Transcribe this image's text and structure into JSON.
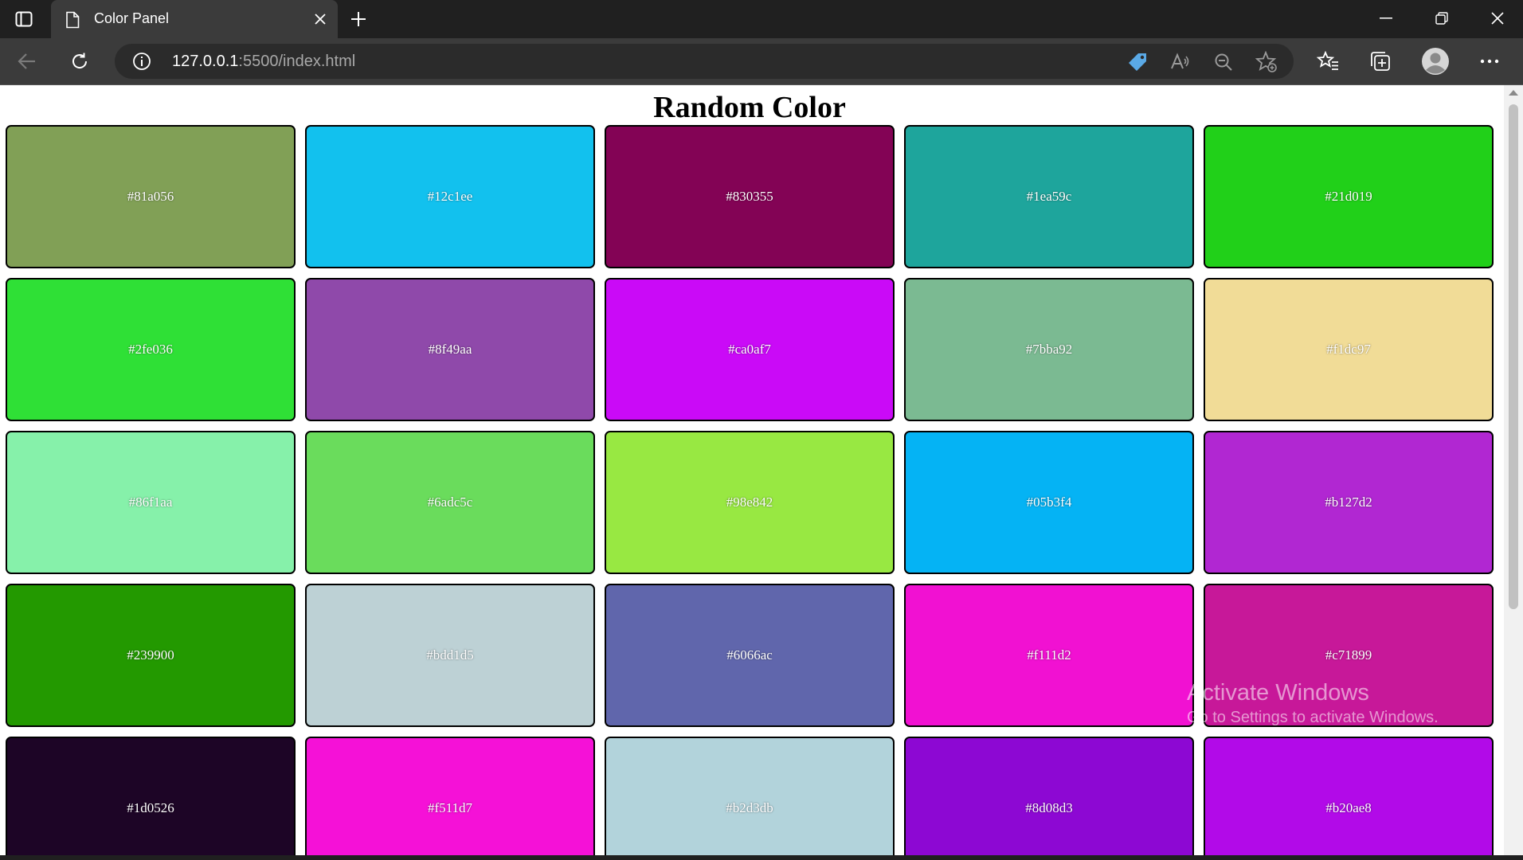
{
  "browser": {
    "tab": {
      "title": "Color Panel"
    },
    "address": {
      "host": "127.0.0.1",
      "rest": ":5500/index.html"
    }
  },
  "page": {
    "heading": "Random Color",
    "swatches": [
      {
        "hex": "#81a056"
      },
      {
        "hex": "#12c1ee"
      },
      {
        "hex": "#830355"
      },
      {
        "hex": "#1ea59c"
      },
      {
        "hex": "#21d019"
      },
      {
        "hex": "#2fe036"
      },
      {
        "hex": "#8f49aa"
      },
      {
        "hex": "#ca0af7"
      },
      {
        "hex": "#7bba92"
      },
      {
        "hex": "#f1dc97"
      },
      {
        "hex": "#86f1aa"
      },
      {
        "hex": "#6adc5c"
      },
      {
        "hex": "#98e842"
      },
      {
        "hex": "#05b3f4"
      },
      {
        "hex": "#b127d2"
      },
      {
        "hex": "#239900"
      },
      {
        "hex": "#bdd1d5"
      },
      {
        "hex": "#6066ac"
      },
      {
        "hex": "#f111d2"
      },
      {
        "hex": "#c71899"
      },
      {
        "hex": "#1d0526"
      },
      {
        "hex": "#f511d7"
      },
      {
        "hex": "#b2d3db"
      },
      {
        "hex": "#8d08d3"
      },
      {
        "hex": "#b20ae8"
      }
    ]
  },
  "watermark": {
    "title": "Activate Windows",
    "subtitle": "Go to Settings to activate Windows."
  }
}
